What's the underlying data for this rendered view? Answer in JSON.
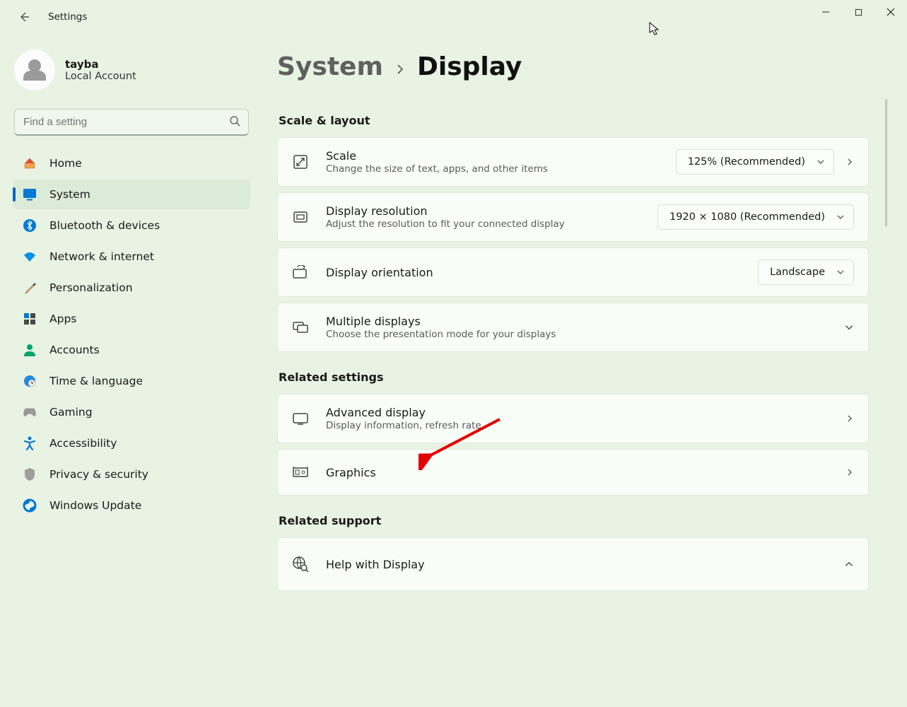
{
  "title": "Settings",
  "user": {
    "name": "tayba",
    "sub": "Local Account"
  },
  "search": {
    "placeholder": "Find a setting"
  },
  "nav": [
    {
      "label": "Home",
      "icon": "home"
    },
    {
      "label": "System",
      "icon": "system",
      "active": true
    },
    {
      "label": "Bluetooth & devices",
      "icon": "bluetooth"
    },
    {
      "label": "Network & internet",
      "icon": "wifi"
    },
    {
      "label": "Personalization",
      "icon": "brush"
    },
    {
      "label": "Apps",
      "icon": "apps"
    },
    {
      "label": "Accounts",
      "icon": "account"
    },
    {
      "label": "Time & language",
      "icon": "time"
    },
    {
      "label": "Gaming",
      "icon": "gaming"
    },
    {
      "label": "Accessibility",
      "icon": "accessibility"
    },
    {
      "label": "Privacy & security",
      "icon": "privacy"
    },
    {
      "label": "Windows Update",
      "icon": "update"
    }
  ],
  "breadcrumb": {
    "parent": "System",
    "current": "Display"
  },
  "sections": {
    "scale_layout": {
      "title": "Scale & layout",
      "scale": {
        "title": "Scale",
        "sub": "Change the size of text, apps, and other items",
        "value": "125% (Recommended)"
      },
      "resolution": {
        "title": "Display resolution",
        "sub": "Adjust the resolution to fit your connected display",
        "value": "1920 × 1080 (Recommended)"
      },
      "orientation": {
        "title": "Display orientation",
        "value": "Landscape"
      },
      "multiple": {
        "title": "Multiple displays",
        "sub": "Choose the presentation mode for your displays"
      }
    },
    "related_settings": {
      "title": "Related settings",
      "advanced": {
        "title": "Advanced display",
        "sub": "Display information, refresh rate"
      },
      "graphics": {
        "title": "Graphics"
      }
    },
    "related_support": {
      "title": "Related support",
      "help": {
        "title": "Help with Display"
      }
    }
  }
}
